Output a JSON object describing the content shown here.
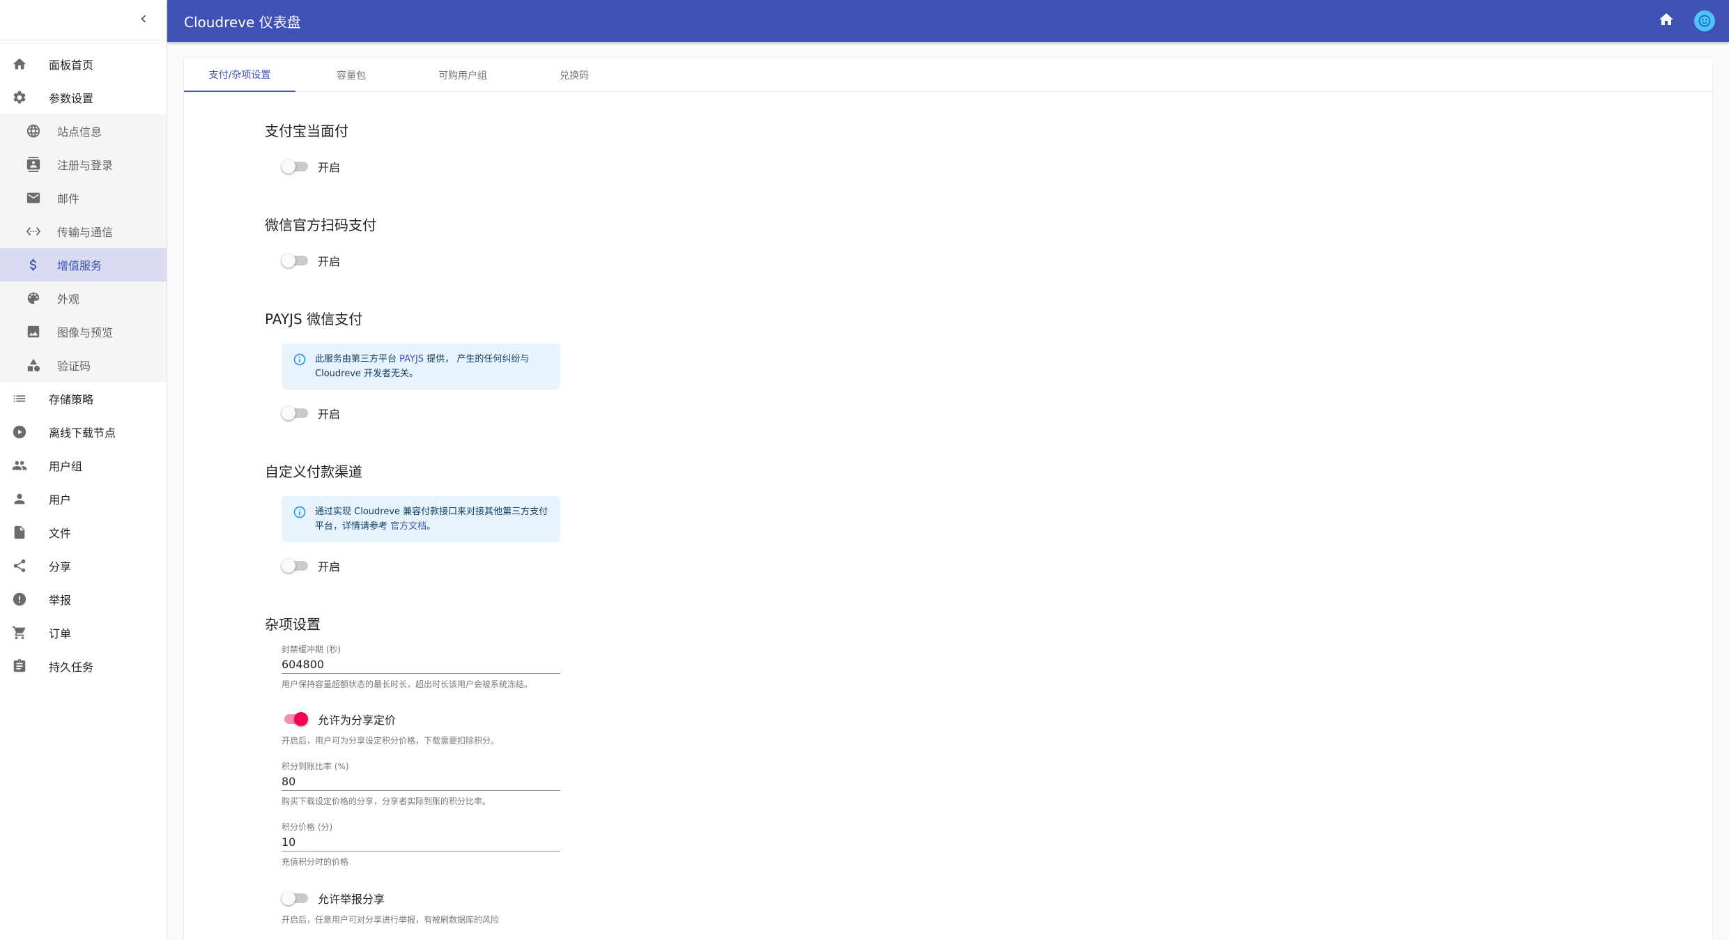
{
  "app": {
    "title": "Cloudreve 仪表盘"
  },
  "sidebar": {
    "items": [
      {
        "label": "面板首页",
        "icon": "home-icon"
      },
      {
        "label": "参数设置",
        "icon": "gear-icon"
      },
      {
        "label": "站点信息",
        "icon": "globe-icon",
        "sub": true
      },
      {
        "label": "注册与登录",
        "icon": "contact-card-icon",
        "sub": true
      },
      {
        "label": "邮件",
        "icon": "mail-icon",
        "sub": true
      },
      {
        "label": "传输与通信",
        "icon": "code-transfer-icon",
        "sub": true
      },
      {
        "label": "增值服务",
        "icon": "dollar-icon",
        "sub": true,
        "active": true
      },
      {
        "label": "外观",
        "icon": "palette-icon",
        "sub": true
      },
      {
        "label": "图像与预览",
        "icon": "image-icon",
        "sub": true
      },
      {
        "label": "验证码",
        "icon": "shapes-icon",
        "sub": true
      },
      {
        "label": "存储策略",
        "icon": "list-icon"
      },
      {
        "label": "离线下载节点",
        "icon": "download-node-icon"
      },
      {
        "label": "用户组",
        "icon": "people-icon"
      },
      {
        "label": "用户",
        "icon": "person-icon"
      },
      {
        "label": "文件",
        "icon": "file-icon"
      },
      {
        "label": "分享",
        "icon": "share-icon"
      },
      {
        "label": "举报",
        "icon": "report-icon"
      },
      {
        "label": "订单",
        "icon": "cart-icon"
      },
      {
        "label": "持久任务",
        "icon": "clipboard-icon"
      }
    ]
  },
  "tabs": [
    "支付/杂项设置",
    "容量包",
    "可购用户组",
    "兑换码"
  ],
  "sections": {
    "alipay": {
      "title": "支付宝当面付",
      "switch_label": "开启",
      "on": false
    },
    "wechat": {
      "title": "微信官方扫码支付",
      "switch_label": "开启",
      "on": false
    },
    "payjs": {
      "title": "PAYJS 微信支付",
      "alert_pre": "此服务由第三方平台 ",
      "alert_link": "PAYJS",
      "alert_post": " 提供， 产生的任何纠纷与 Cloudreve 开发者无关。",
      "switch_label": "开启",
      "on": false
    },
    "custom": {
      "title": "自定义付款渠道",
      "alert_pre": "通过实现 Cloudreve 兼容付款接口来对接其他第三方支付平台，详情请参考 ",
      "alert_link": "官方文档",
      "alert_post": "。",
      "switch_label": "开启",
      "on": false
    },
    "misc": {
      "title": "杂项设置",
      "ban_label": "封禁缓冲期 (秒)",
      "ban_value": "604800",
      "ban_helper": "用户保持容量超额状态的最长时长，超出时长该用户会被系统冻结。",
      "share_price_label": "允许为分享定价",
      "share_price_on": true,
      "share_price_helper": "开启后，用户可为分享设定积分价格，下载需要扣除积分。",
      "ratio_label": "积分到账比率 (%)",
      "ratio_value": "80",
      "ratio_helper": "购买下载设定价格的分享，分享者实际到账的积分比率。",
      "price_label": "积分价格 (分)",
      "price_value": "10",
      "price_helper": "充值积分时的价格",
      "report_label": "允许举报分享",
      "report_on": false,
      "report_helper": "开启后，任意用户可对分享进行举报，有被刷数据库的风险"
    }
  },
  "colors": {
    "primary": "#3f51b5",
    "secondary": "#f50057",
    "info_bg": "#e8f4fd"
  }
}
